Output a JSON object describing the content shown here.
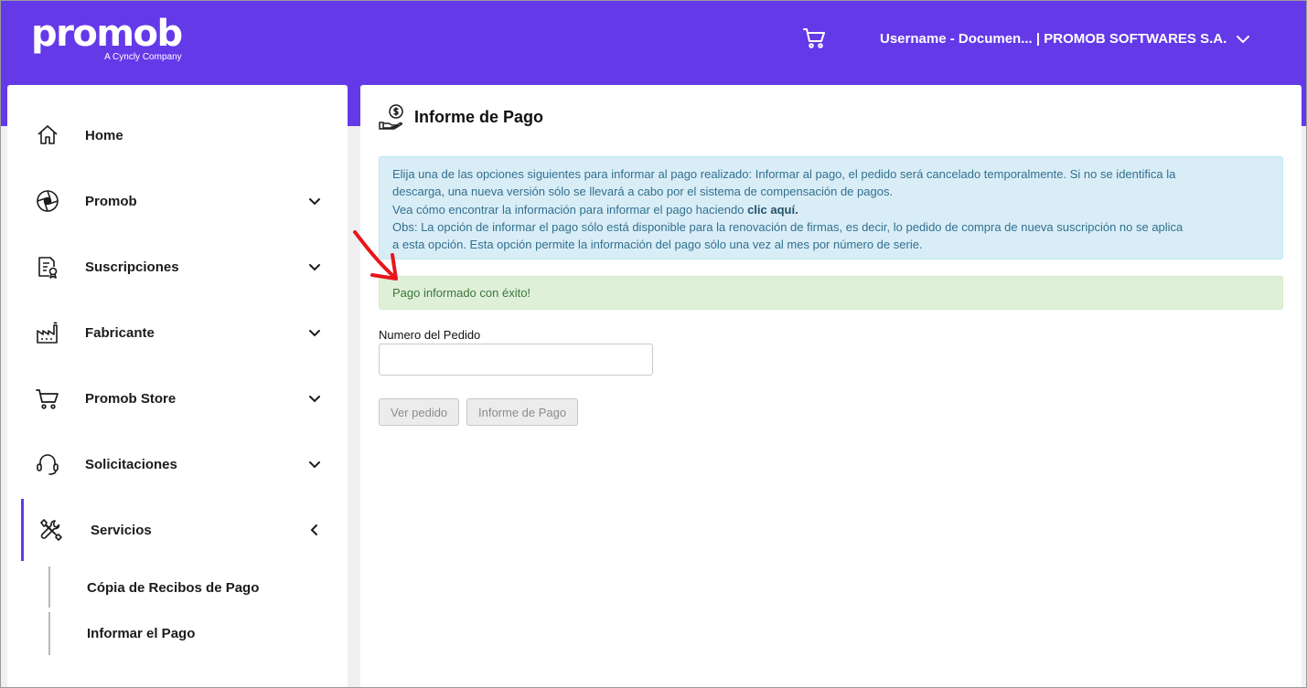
{
  "header": {
    "logo_text": "promob",
    "logo_sub": "A Cyncly Company",
    "user_label": "Username - Documen... | PROMOB SOFTWARES S.A."
  },
  "sidebar": {
    "items": [
      {
        "label": "Home",
        "icon": "home-icon"
      },
      {
        "label": "Promob",
        "icon": "aperture-icon"
      },
      {
        "label": "Suscripciones",
        "icon": "certificate-icon"
      },
      {
        "label": "Fabricante",
        "icon": "factory-icon"
      },
      {
        "label": "Promob Store",
        "icon": "cart-icon"
      },
      {
        "label": "Solicitaciones",
        "icon": "headset-icon"
      },
      {
        "label": "Servicios",
        "icon": "tools-icon"
      }
    ],
    "sub_items": [
      "Cópia de Recibos de Pago",
      "Informar el Pago"
    ]
  },
  "main": {
    "title": "Informe de Pago",
    "info": {
      "line1": "Elija una de las opciones siguientes para informar al pago realizado: Informar al pago, el pedido será cancelado temporalmente. Si no se identifica la",
      "line2": "descarga, una nueva versión sólo se llevará a cabo por el sistema de compensación de pagos.",
      "line3_prefix": "Vea cómo encontrar la información para informar el pago haciendo ",
      "line3_link": "clic aquí.",
      "line4": "Obs: La opción de informar el pago sólo está disponible para la renovación de firmas, es decir, lo pedido de compra de nueva suscripción no se aplica",
      "line5": "a esta opción. Esta opción permite la información del pago sólo una vez al mes por número de serie."
    },
    "success": "Pago informado con éxito!",
    "order_label": "Numero del Pedido",
    "order_value": "",
    "btn_view": "Ver pedido",
    "btn_report": "Informe de Pago"
  },
  "colors": {
    "brand": "#6439e8",
    "annotation_arrow": "#e8151b"
  }
}
